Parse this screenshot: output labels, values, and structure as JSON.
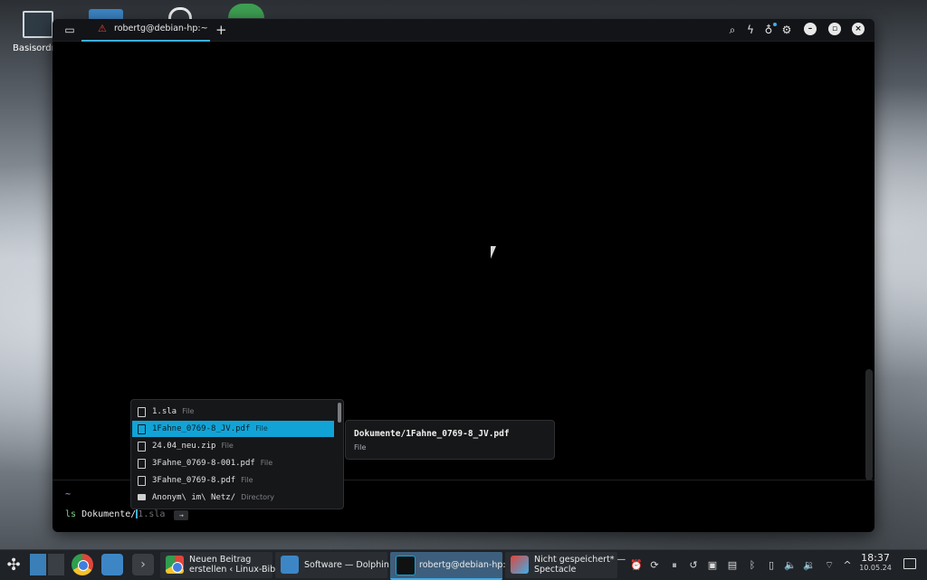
{
  "desktop": {
    "icon_label": "Basisordner"
  },
  "window": {
    "tab_title": "robertg@debian-hp:~",
    "new_tab": "+"
  },
  "terminal": {
    "prompt_dir": "~",
    "command": "ls",
    "typed_arg": "Dokumente/",
    "ghost_suggestion": "1.sla",
    "accept_hint": "→"
  },
  "completion": {
    "items": [
      {
        "name": "1.sla",
        "kind": "File",
        "icon": "file-icon"
      },
      {
        "name": "1Fahne_0769-8_JV.pdf",
        "kind": "File",
        "icon": "file-icon",
        "selected": true
      },
      {
        "name": "24.04_neu.zip",
        "kind": "File",
        "icon": "file-icon"
      },
      {
        "name": "3Fahne_0769-8-001.pdf",
        "kind": "File",
        "icon": "file-icon"
      },
      {
        "name": "3Fahne_0769-8.pdf",
        "kind": "File",
        "icon": "file-icon"
      },
      {
        "name": "Anonym\\ im\\ Netz/",
        "kind": "Directory",
        "icon": "folder-icon"
      }
    ],
    "detail": {
      "path": "Dokumente/1Fahne_0769-8_JV.pdf",
      "kind": "File"
    }
  },
  "taskbar": {
    "tasks": [
      {
        "label_line1": "Neuen Beitrag",
        "label_line2": "erstellen ‹ Linux-Bib..."
      },
      {
        "label_line1": "Software — Dolphin"
      },
      {
        "label_line1": "robertg@debian-hp:~"
      },
      {
        "label_line1": "Nicht gespeichert* —",
        "label_line2": "Spectacle"
      }
    ],
    "clock": {
      "time": "18:37",
      "date": "10.05.24"
    }
  },
  "colors": {
    "accent": "#3daee9",
    "selection": "#12a3d6",
    "warning": "#e0463b"
  }
}
